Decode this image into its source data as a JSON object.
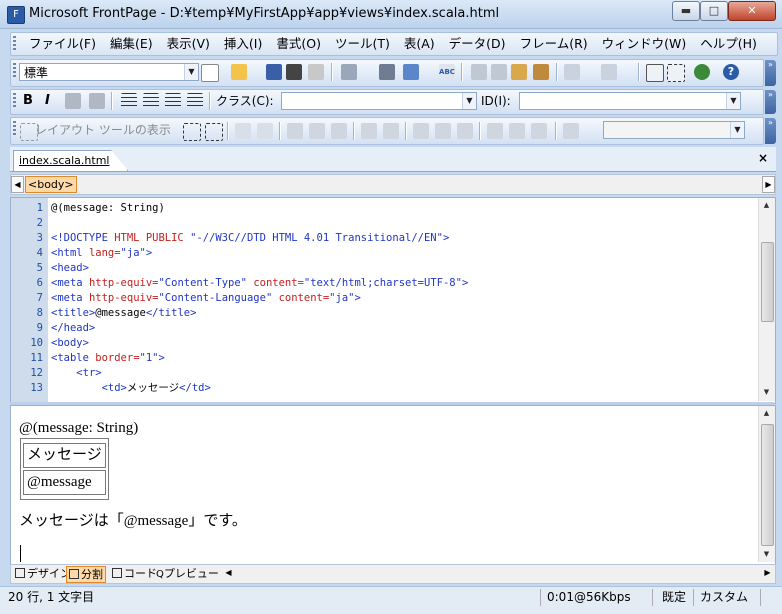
{
  "window": {
    "title": "Microsoft FrontPage - D:¥temp¥MyFirstApp¥app¥views¥index.scala.html",
    "controls": {
      "minimize": "▬",
      "maximize": "□",
      "close": "✕"
    }
  },
  "menu": [
    "ファイル(F)",
    "編集(E)",
    "表示(V)",
    "挿入(I)",
    "書式(O)",
    "ツール(T)",
    "表(A)",
    "データ(D)",
    "フレーム(R)",
    "ウィンドウ(W)",
    "ヘルプ(H)"
  ],
  "toolbar_standard": {
    "style_combo": "標準"
  },
  "toolbar_format": {
    "bold": "B",
    "italic": "I",
    "class_label": "クラス(C):",
    "class_value": "",
    "id_label": "ID(I):",
    "id_value": ""
  },
  "toolbar_layout": {
    "layout_tools_label": "レイアウト ツールの表示",
    "combo_value": ""
  },
  "document_tab": {
    "filename": "index.scala.html",
    "close": "×"
  },
  "tag_bar": {
    "selected_tag": "<body>"
  },
  "code_lines": [
    {
      "n": "1",
      "parts": [
        [
          "txt",
          "@(message: String)"
        ]
      ]
    },
    {
      "n": "2",
      "parts": []
    },
    {
      "n": "3",
      "parts": [
        [
          "tag",
          "<!DOCTYPE "
        ],
        [
          "attr",
          "HTML PUBLIC "
        ],
        [
          "val",
          "\"-//W3C//DTD HTML 4.01 Transitional//EN\""
        ],
        [
          "tag",
          ">"
        ]
      ]
    },
    {
      "n": "4",
      "parts": [
        [
          "tag",
          "<html "
        ],
        [
          "attr",
          "lang="
        ],
        [
          "val",
          "\"ja\""
        ],
        [
          "tag",
          ">"
        ]
      ]
    },
    {
      "n": "5",
      "parts": [
        [
          "tag",
          "<head>"
        ]
      ]
    },
    {
      "n": "6",
      "parts": [
        [
          "tag",
          "<meta "
        ],
        [
          "attr",
          "http-equiv="
        ],
        [
          "val",
          "\"Content-Type\" "
        ],
        [
          "attr",
          "content="
        ],
        [
          "val",
          "\"text/html;charset=UTF-8\""
        ],
        [
          "tag",
          ">"
        ]
      ]
    },
    {
      "n": "7",
      "parts": [
        [
          "tag",
          "<meta "
        ],
        [
          "attr",
          "http-equiv="
        ],
        [
          "val",
          "\"Content-Language\" "
        ],
        [
          "attr",
          "content="
        ],
        [
          "val",
          "\"ja\""
        ],
        [
          "tag",
          ">"
        ]
      ]
    },
    {
      "n": "8",
      "parts": [
        [
          "tag",
          "<title>"
        ],
        [
          "txt",
          "@message"
        ],
        [
          "tag",
          "</title>"
        ]
      ]
    },
    {
      "n": "9",
      "parts": [
        [
          "tag",
          "</head>"
        ]
      ]
    },
    {
      "n": "10",
      "parts": [
        [
          "tag",
          "<body>"
        ]
      ]
    },
    {
      "n": "11",
      "parts": [
        [
          "tag",
          "<table "
        ],
        [
          "attr",
          "border="
        ],
        [
          "val",
          "\"1\""
        ],
        [
          "tag",
          ">"
        ]
      ]
    },
    {
      "n": "12",
      "parts": [
        [
          "txt",
          "    "
        ],
        [
          "tag",
          "<tr>"
        ]
      ]
    },
    {
      "n": "13",
      "parts": [
        [
          "txt",
          "        "
        ],
        [
          "tag",
          "<td>"
        ],
        [
          "txt",
          "メッセージ"
        ],
        [
          "tag",
          "</td>"
        ]
      ]
    }
  ],
  "design": {
    "heading": "@(message: String)",
    "table_cells": [
      "メッセージ",
      "@message"
    ],
    "paragraph": "メッセージは「@message」です。"
  },
  "view_tabs": [
    {
      "label": "デザイン",
      "active": false
    },
    {
      "label": "分割",
      "active": true
    },
    {
      "label": "コード",
      "active": false
    },
    {
      "label": "プレビュー",
      "active": false
    }
  ],
  "status": {
    "position": "20 行, 1 文字目",
    "speed": "0:01@56Kbps",
    "mode": "既定",
    "custom": "カスタム"
  },
  "colors": {
    "accent": "#2b5aa8",
    "code_tag": "#1f36c4",
    "code_attr": "#c41f1f",
    "active_tab": "#ffd9a8"
  }
}
